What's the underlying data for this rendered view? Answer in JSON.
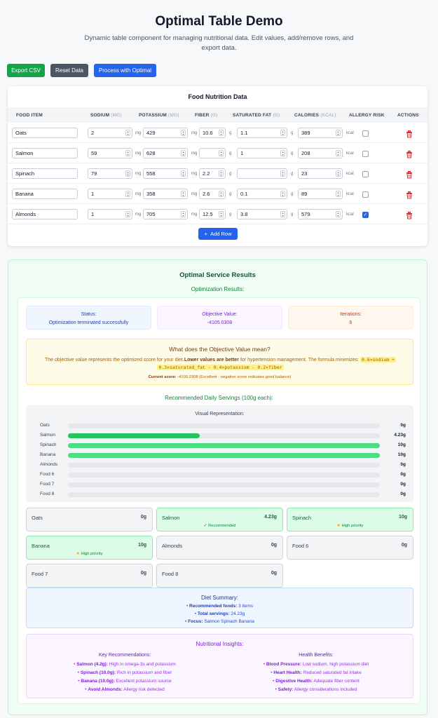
{
  "page": {
    "title": "Optimal Table Demo",
    "subtitle": "Dynamic table component for managing nutritional data. Edit values, add/remove rows, and export data."
  },
  "toolbar": {
    "export_label": "Export CSV",
    "reset_label": "Reset Data",
    "process_label": "Process with Optimal"
  },
  "table": {
    "title": "Food Nutrition Data",
    "headers": {
      "food_item": "FOOD ITEM",
      "sodium": "SODIUM",
      "sodium_unit": "(MG)",
      "potassium": "POTASSIUM",
      "potassium_unit": "(MG)",
      "fiber": "FIBER",
      "fiber_unit": "(G)",
      "sat_fat": "SATURATED FAT",
      "sat_fat_unit": "(G)",
      "calories": "CALORIES",
      "calories_unit": "(KCAL)",
      "allergy": "ALLERGY RISK",
      "actions": "ACTIONS"
    },
    "units": {
      "mg": "mg",
      "g": "g",
      "kcal": "kcal"
    },
    "rows": [
      {
        "name": "Oats",
        "sodium": "2",
        "potassium": "429",
        "fiber": "10.6",
        "sat_fat": "1.1",
        "calories": "389",
        "allergy": false
      },
      {
        "name": "Salmon",
        "sodium": "59",
        "potassium": "628",
        "fiber": "",
        "sat_fat": "1",
        "calories": "208",
        "allergy": false
      },
      {
        "name": "Spinach",
        "sodium": "79",
        "potassium": "558",
        "fiber": "2.2",
        "sat_fat": "",
        "calories": "23",
        "allergy": false
      },
      {
        "name": "Banana",
        "sodium": "1",
        "potassium": "358",
        "fiber": "2.6",
        "sat_fat": "0.1",
        "calories": "89",
        "allergy": false
      },
      {
        "name": "Almonds",
        "sodium": "1",
        "potassium": "705",
        "fiber": "12.5",
        "sat_fat": "3.8",
        "calories": "579",
        "allergy": true
      }
    ],
    "add_row_label": "Add Row",
    "add_row_icon": "+"
  },
  "results": {
    "title": "Optimal Service Results",
    "subtitle": "Optimization Results:",
    "status_label": "Status:",
    "status_value": "Optimization terminated successfully",
    "objective_label": "Objective Value:",
    "objective_value": "-4105.0308",
    "iterations_label": "Iterations:",
    "iterations_value": "6",
    "explain_title": "What does the Objective Value mean?",
    "explain_text_1": "The objective value represents the optimized score for your diet.",
    "explain_bold": "Lower values are better",
    "explain_text_2": " for hypertension management. The formula minimizes: ",
    "explain_formula_1": "0.6×sodium +",
    "explain_formula_2": "0.3×saturated_fat - 0.4×potassium - 0.2×fiber",
    "current_score_label": "Current score:",
    "current_score_text": " -4105.0308 (Excellent - negative score indicates good balance)",
    "servings_title": "Recommended Daily Servings (100g each):",
    "visual_title": "Visual Representation:",
    "servings": [
      {
        "name": "Oats",
        "grams": 0,
        "label": "0g"
      },
      {
        "name": "Salmon",
        "grams": 4.23,
        "label": "4.23g"
      },
      {
        "name": "Spinach",
        "grams": 10,
        "label": "10g"
      },
      {
        "name": "Banana",
        "grams": 10,
        "label": "10g"
      },
      {
        "name": "Almonds",
        "grams": 0,
        "label": "0g"
      },
      {
        "name": "Food 6",
        "grams": 0,
        "label": "0g"
      },
      {
        "name": "Food 7",
        "grams": 0,
        "label": "0g"
      },
      {
        "name": "Food 8",
        "grams": 0,
        "label": "0g"
      }
    ],
    "cards": [
      {
        "name": "Oats",
        "value": "0g",
        "tag": ""
      },
      {
        "name": "Salmon",
        "value": "4.23g",
        "tag": "✓ Recommended"
      },
      {
        "name": "Spinach",
        "value": "10g",
        "tag": "High priority"
      },
      {
        "name": "Banana",
        "value": "10g",
        "tag": "High priority"
      },
      {
        "name": "Almonds",
        "value": "0g",
        "tag": ""
      },
      {
        "name": "Food 6",
        "value": "0g",
        "tag": ""
      },
      {
        "name": "Food 7",
        "value": "0g",
        "tag": ""
      },
      {
        "name": "Food 8",
        "value": "0g",
        "tag": ""
      }
    ],
    "summary": {
      "title": "Diet Summary:",
      "recommended_label": "Recommended foods:",
      "recommended_value": " 3 items",
      "total_label": "Total servings:",
      "total_value": " 24.23g",
      "focus_label": "Focus:",
      "focus_value": " Salmon Spinach Banana"
    },
    "insights": {
      "title": "Nutritional Insights:",
      "key_title": "Key Recommendations:",
      "key_items": [
        {
          "b": "Salmon (4.2g):",
          "t": " High in omega-3s and potassium"
        },
        {
          "b": "Spinach (10.0g):",
          "t": " Rich in potassium and fiber"
        },
        {
          "b": "Banana (10.0g):",
          "t": " Excellent potassium source"
        },
        {
          "b": "Avoid Almonds:",
          "t": " Allergy risk detected"
        }
      ],
      "health_title": "Health Benefits:",
      "health_items": [
        {
          "b": "Blood Pressure:",
          "t": " Low sodium, high potassium diet"
        },
        {
          "b": "Heart Health:",
          "t": " Reduced saturated fat intake"
        },
        {
          "b": "Digestive Health:",
          "t": " Adequate fiber content"
        },
        {
          "b": "Safety:",
          "t": " Allergy considerations included"
        }
      ]
    }
  },
  "colors": {
    "green": "#16a34a",
    "blue": "#2563eb",
    "gray": "#4b5563",
    "danger": "#dc2626"
  }
}
